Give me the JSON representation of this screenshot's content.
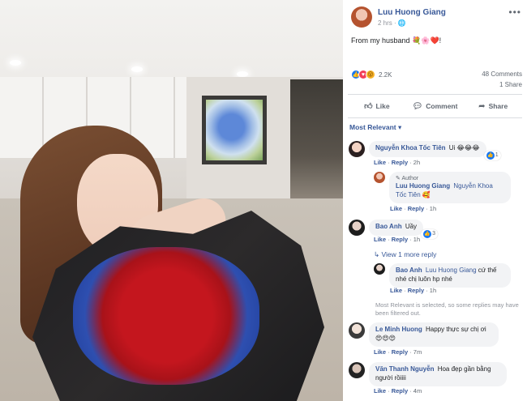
{
  "post": {
    "author": "Luu Huong Giang",
    "time": "2 hrs · ",
    "globe_icon": "globe-icon",
    "text": "From my husband ",
    "text_emojis": "💐🌸❤️!",
    "more_label": "•••"
  },
  "reactions": {
    "count": "2.2K",
    "types": [
      "like",
      "love",
      "wow"
    ]
  },
  "stats": {
    "comments": "48 Comments",
    "shares": "1 Share"
  },
  "actions": {
    "like": "Like",
    "comment": "Comment",
    "share": "Share"
  },
  "sort_label": "Most Relevant ▾",
  "comments": [
    {
      "name": "Nguyễn Khoa Tốc Tiên",
      "text": "Ui 😂😂😂",
      "reaction_count": "1",
      "like": "Like",
      "reply": "Reply",
      "time": "2h"
    },
    {
      "author_label": "Author",
      "name": "Luu Huong Giang",
      "tag": "Nguyễn Khoa Tốc Tiên",
      "text": "🥰",
      "like": "Like",
      "reply": "Reply",
      "time": "1h"
    },
    {
      "name": "Bao Anh",
      "text": "Uầy",
      "reaction_count": "3",
      "like": "Like",
      "reply": "Reply",
      "time": "1h"
    },
    {
      "name": "Bao Anh",
      "tag": "Luu Huong Giang",
      "text": "cứ thế nhé chị luôn hp nhé",
      "like": "Like",
      "reply": "Reply",
      "time": "1h"
    },
    {
      "name": "Le Minh Huong",
      "text": "Happy thực sự chị ơi 😍😍😍",
      "like": "Like",
      "reply": "Reply",
      "time": "7m"
    },
    {
      "name": "Văn Thanh Nguyễn",
      "text": "Hoa đẹp gần bằng người rồiiii",
      "like": "Like",
      "reply": "Reply",
      "time": "4m"
    }
  ],
  "view_more_replies": "View 1 more reply",
  "filter_note": "Most Relevant is selected, so some replies may have been filtered out.",
  "colors": {
    "link": "#385898",
    "like": "#1877f2",
    "love": "#f33e58",
    "wow": "#f7b125",
    "bubble": "#f2f3f5"
  }
}
